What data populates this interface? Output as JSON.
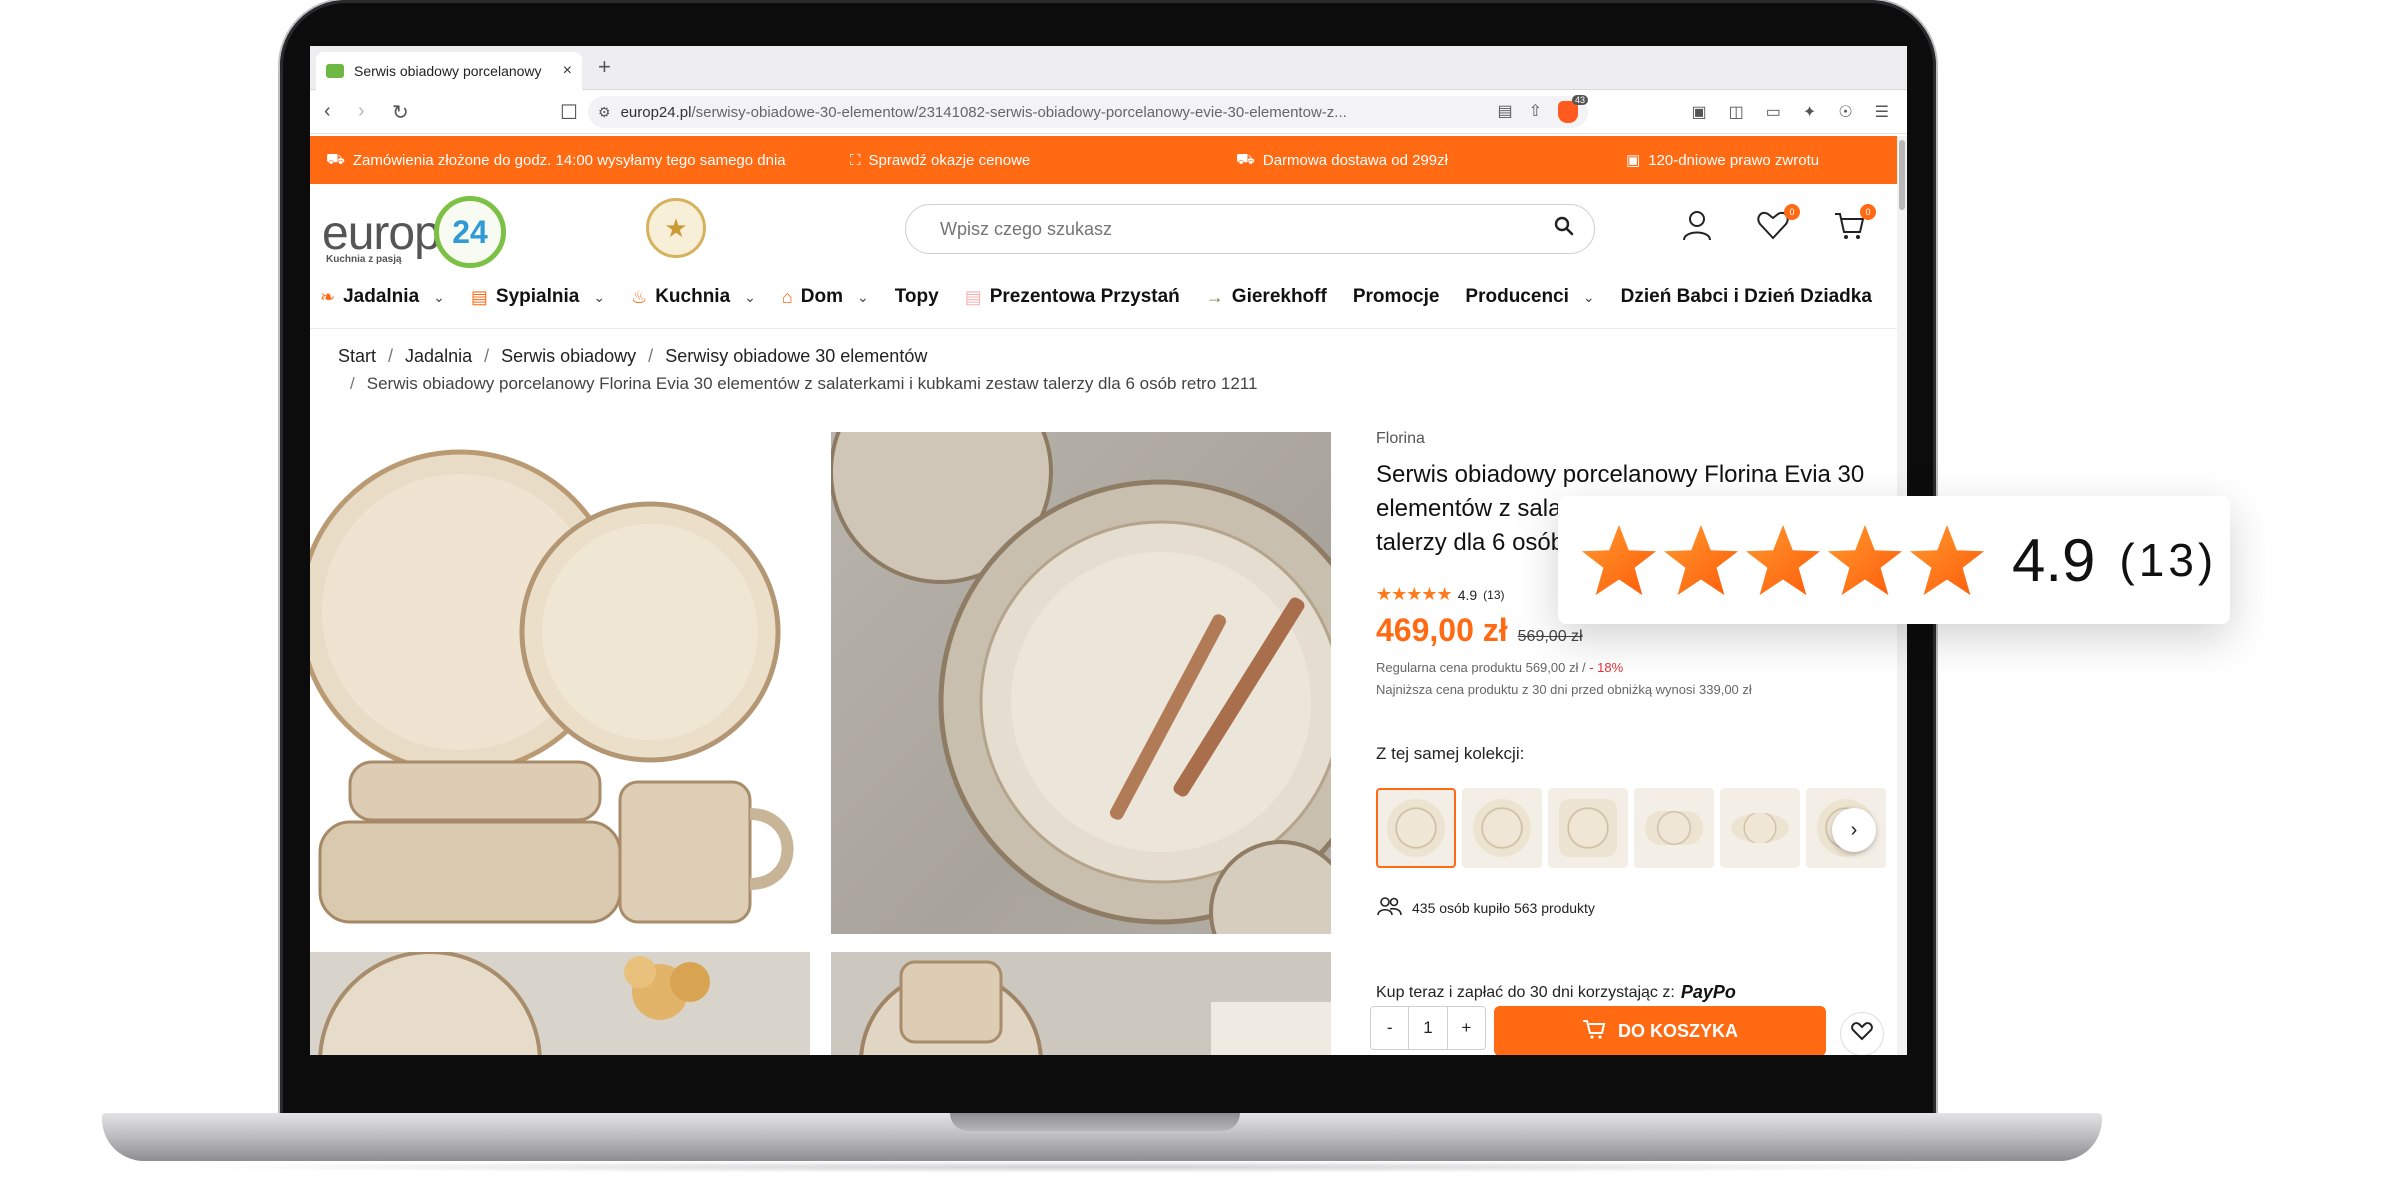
{
  "browser": {
    "tab_title": "Serwis obiadowy porcelanowy",
    "new_tab": "+",
    "close": "×",
    "url_domain": "europ24.pl",
    "url_path": "/serwisy-obiadowe-30-elementow/23141082-serwis-obiadowy-porcelanowy-evie-30-elementow-z...",
    "brave_badge": "43"
  },
  "promo": {
    "item1": "Zamówienia złożone do godz. 14:00 wysyłamy tego samego dnia",
    "item2": "Sprawdź okazje cenowe",
    "item3": "Darmowa dostawa od 299zł",
    "item4": "120-dniowe prawo zwrotu"
  },
  "header": {
    "logo_text": "europ",
    "logo_number": "24",
    "logo_tagline": "Kuchnia z pasją",
    "search_placeholder": "Wpisz czego szukasz",
    "wishlist_count": "0",
    "cart_count": "0"
  },
  "menu": {
    "items": [
      "Jadalnia",
      "Sypialnia",
      "Kuchnia",
      "Dom",
      "Topy",
      "Prezentowa Przystań",
      "Gierekhoff",
      "Promocje",
      "Producenci",
      "Dzień Babci i Dzień Dziadka"
    ]
  },
  "breadcrumb": {
    "items": [
      "Start",
      "Jadalnia",
      "Serwis obiadowy",
      "Serwisy obiadowe 30 elementów"
    ],
    "current": "Serwis obiadowy porcelanowy Florina Evia 30 elementów z salaterkami i kubkami zestaw talerzy dla 6 osób retro 1211",
    "separator": "/"
  },
  "product": {
    "brand": "Florina",
    "title": "Serwis obiadowy porcelanowy Florina Evia 30 elementów z salaterkami i kubkami zestaw talerzy dla 6 osób retro 1211",
    "title_visible": "Serwis obiadowy porcelanowy Florina Evia 30 elementów z sala",
    "title_visible_line3": "talerzy dla 6 osób",
    "rating": "4.9",
    "rating_count": "(13)",
    "rating_value": 4.9,
    "price": "469,00 zł",
    "old_price": "569,00 zł",
    "regular_price_text": "Regularna cena produktu 569,00 zł / ",
    "discount": "- 18%",
    "lowest_price_text": "Najniższa cena produktu z 30 dni przed obniżką wynosi 339,00 zł",
    "collection_label": "Z tej samej kolekcji:",
    "buyers_text": "435 osób kupiło 563 produkty",
    "paypo_text": "Kup teraz i zapłać do 30 dni korzystając z:",
    "paypo_logo": "PayPo",
    "qty_minus": "-",
    "qty_value": "1",
    "qty_plus": "+",
    "cart_button": "DO KOSZYKA"
  },
  "callout": {
    "score": "4.9",
    "count": "(13)"
  },
  "colors": {
    "brand_orange": "#ff6a13",
    "star_orange": "#ff7a1a",
    "discount_red": "#e2313b",
    "logo_green": "#7cc145",
    "logo_blue": "#2f9ad3"
  }
}
